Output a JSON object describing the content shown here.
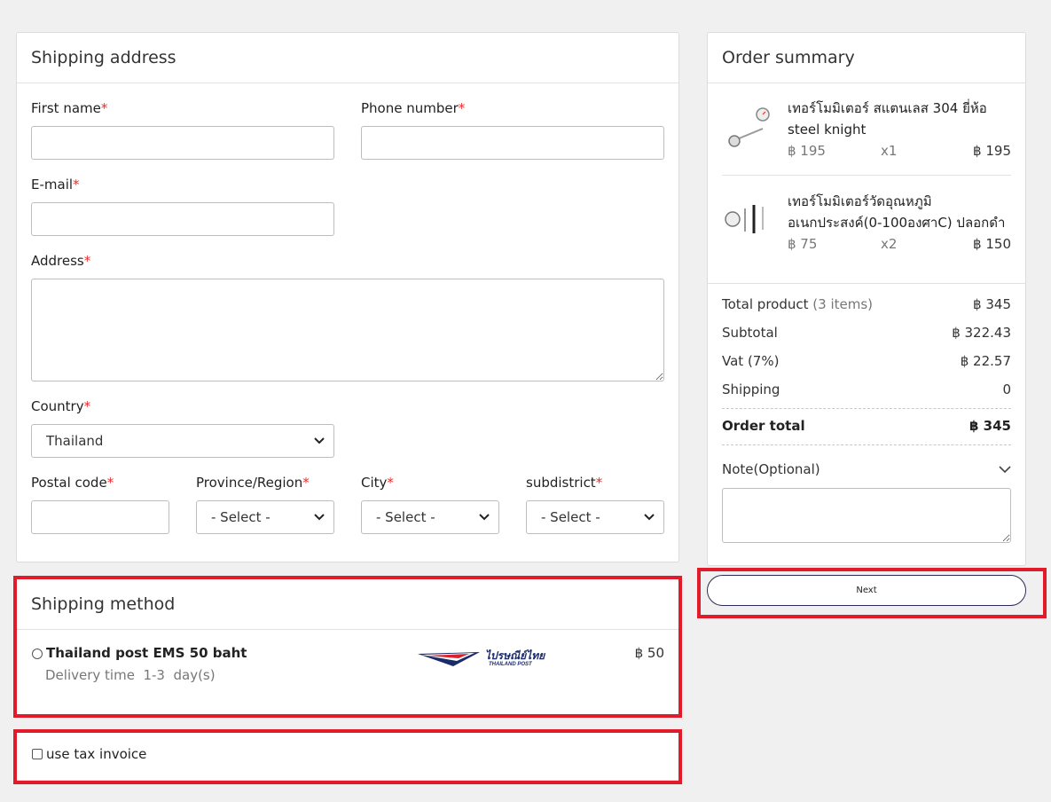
{
  "shipping_address": {
    "title": "Shipping address",
    "first_name_label": "First name",
    "phone_label": "Phone number",
    "email_label": "E-mail",
    "address_label": "Address",
    "country_label": "Country",
    "country_value": "Thailand",
    "postal_label": "Postal code",
    "province_label": "Province/Region",
    "city_label": "City",
    "subdistrict_label": "subdistrict",
    "select_placeholder": "- Select -",
    "required_mark": "*"
  },
  "shipping_method": {
    "title": "Shipping method",
    "option_name": "Thailand post EMS 50 baht",
    "delivery_time": "Delivery time  1-3  day(s)",
    "price": "฿ 50",
    "logo_text": "ไปรษณีย์ไทย",
    "logo_subtext": "THAILAND POST"
  },
  "tax_invoice": {
    "label": "use tax invoice"
  },
  "order_summary": {
    "title": "Order summary",
    "items": [
      {
        "name_line1": "เทอร์โมมิเตอร์ สแตนเลส 304 ยี่ห้อ",
        "name_line2": "steel knight",
        "unit_price": "฿ 195",
        "qty": "x1",
        "total": "฿ 195"
      },
      {
        "name_line1": "เทอร์โมมิเตอร์วัดอุณหภูมิ",
        "name_line2": "อเนกประสงค์(0-100องศาC) ปลอกดำ",
        "unit_price": "฿ 75",
        "qty": "x2",
        "total": "฿ 150"
      }
    ],
    "total_product_label": "Total product",
    "total_product_count": "(3 items)",
    "total_product_value": "฿ 345",
    "subtotal_label": "Subtotal",
    "subtotal_value": "฿ 322.43",
    "vat_label": "Vat (7%)",
    "vat_value": "฿ 22.57",
    "shipping_label": "Shipping",
    "shipping_value": "0",
    "order_total_label": "Order total",
    "order_total_value": "฿ 345",
    "note_label": "Note(Optional)"
  },
  "next_button": {
    "label": "Next"
  },
  "colors": {
    "highlight": "#e21b2b",
    "required": "#e23030",
    "button_border": "#2b2b55"
  }
}
